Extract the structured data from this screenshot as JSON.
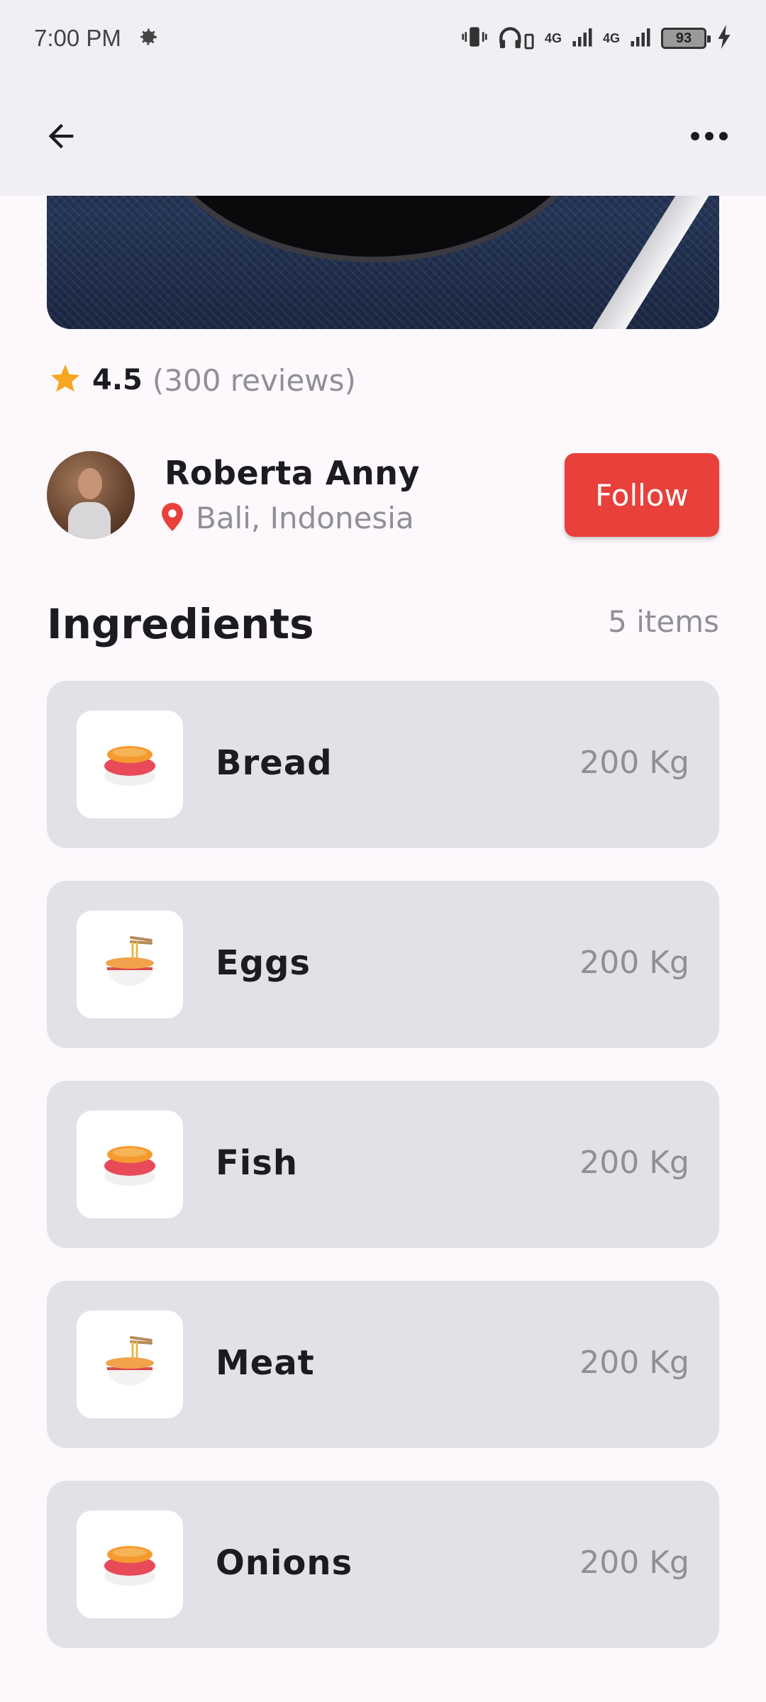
{
  "status_bar": {
    "time": "7:00 PM",
    "network_label": "4G",
    "network_label_2": "4G",
    "battery": "93",
    "icons": [
      "settings-icon",
      "vibrate-icon",
      "headphones-icon",
      "signal-icon",
      "battery-icon",
      "charging-icon"
    ]
  },
  "app_bar": {
    "back_icon": "arrow-back-icon",
    "more_icon": "more-horizontal-icon"
  },
  "rating": {
    "value": "4.5",
    "reviews": "(300 reviews)",
    "star_color": "#f6a623"
  },
  "author": {
    "name": "Roberta Anny",
    "location": "Bali, Indonesia",
    "follow_label": "Follow",
    "accent_color": "#e8403a"
  },
  "ingredients": {
    "title": "Ingredients",
    "count": "5 items",
    "items": [
      {
        "name": "Bread",
        "quantity": "200 Kg",
        "icon": "sushi-icon"
      },
      {
        "name": "Eggs",
        "quantity": "200 Kg",
        "icon": "noodle-bowl-icon"
      },
      {
        "name": "Fish",
        "quantity": "200 Kg",
        "icon": "sushi-icon"
      },
      {
        "name": "Meat",
        "quantity": "200 Kg",
        "icon": "noodle-bowl-icon"
      },
      {
        "name": "Onions",
        "quantity": "200 Kg",
        "icon": "sushi-icon"
      }
    ]
  }
}
